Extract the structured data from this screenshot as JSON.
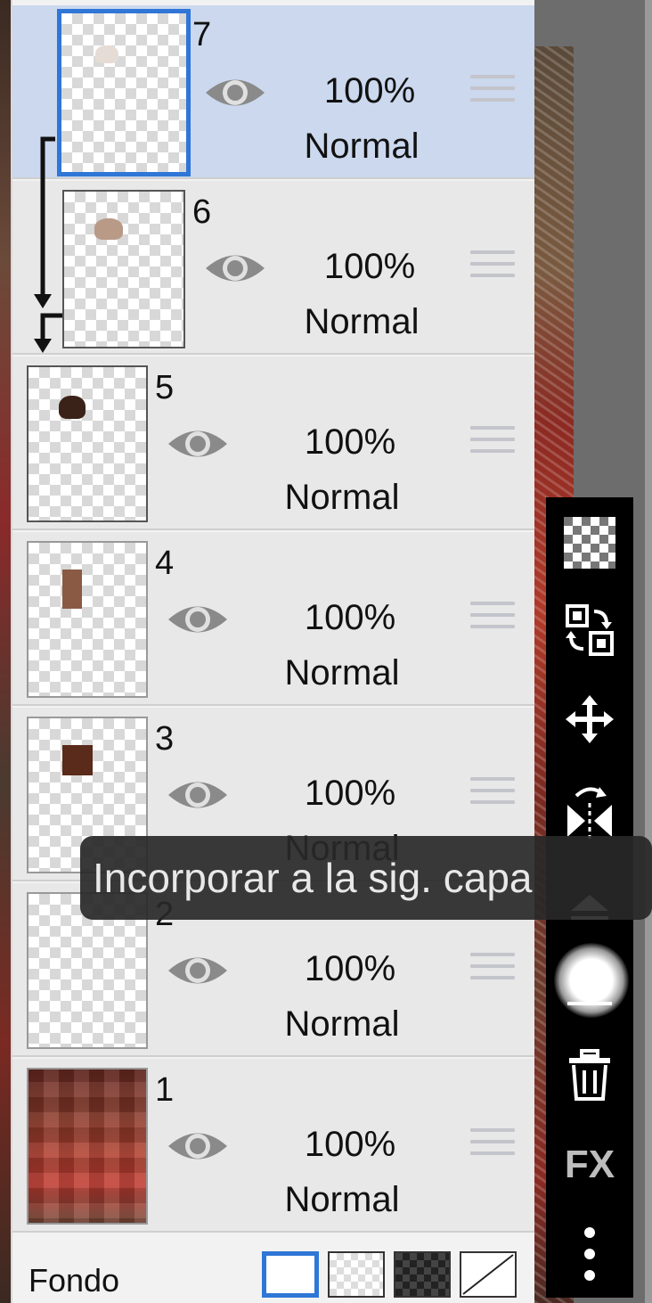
{
  "layers": [
    {
      "number": "7",
      "opacity": "100%",
      "blend": "Normal",
      "selected": true,
      "visibility_icon": "eye-icon",
      "handle_icon": "drag-handle-icon"
    },
    {
      "number": "6",
      "opacity": "100%",
      "blend": "Normal",
      "selected": false,
      "visibility_icon": "eye-icon",
      "handle_icon": "drag-handle-icon"
    },
    {
      "number": "5",
      "opacity": "100%",
      "blend": "Normal",
      "selected": false,
      "visibility_icon": "eye-icon",
      "handle_icon": "drag-handle-icon"
    },
    {
      "number": "4",
      "opacity": "100%",
      "blend": "Normal",
      "selected": false,
      "visibility_icon": "eye-icon",
      "handle_icon": "drag-handle-icon"
    },
    {
      "number": "3",
      "opacity": "100%",
      "blend": "Normal",
      "selected": false,
      "visibility_icon": "eye-icon",
      "handle_icon": "drag-handle-icon"
    },
    {
      "number": "2",
      "opacity": "100%",
      "blend": "Normal",
      "selected": false,
      "visibility_icon": "eye-icon",
      "handle_icon": "drag-handle-icon"
    },
    {
      "number": "1",
      "opacity": "100%",
      "blend": "Normal",
      "selected": false,
      "visibility_icon": "eye-icon",
      "handle_icon": "drag-handle-icon"
    }
  ],
  "bottom_bar": {
    "label": "Fondo",
    "options": [
      "white",
      "transparent-light",
      "transparent-dark",
      "none"
    ],
    "selected_option": "white"
  },
  "toolbar": {
    "items": [
      "transparency-icon",
      "swap-layers-icon",
      "move-icon",
      "flip-icon",
      "merge-down-icon",
      "light-icon",
      "trash-icon",
      "fx-label",
      "more-icon"
    ],
    "fx_label": "FX"
  },
  "tooltip": {
    "text": "Incorporar a la sig. capa"
  },
  "colors": {
    "selected_row": "#cbd8ee",
    "row": "#e8e8e8",
    "accent": "#2f76d6",
    "toolbar": "#000000"
  }
}
